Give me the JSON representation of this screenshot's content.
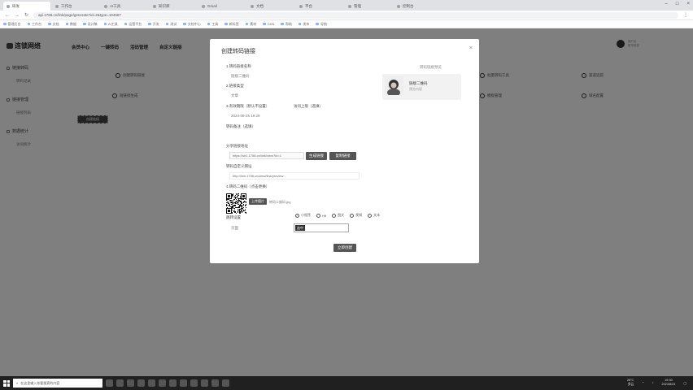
{
  "browser": {
    "tabs": [
      {
        "title": "研发",
        "active": true
      },
      {
        "title": "工作台"
      },
      {
        "title": "AI工具"
      },
      {
        "title": "知识库"
      },
      {
        "title": "Gmail"
      },
      {
        "title": "文档"
      },
      {
        "title": "平台"
      },
      {
        "title": "管理"
      },
      {
        "title": "控制台"
      }
    ],
    "url": "api.1758.cn/link/page/generate?id=2&type=104587",
    "bookmarks": [
      "管理后台",
      "工作台",
      "文档",
      "数据",
      "设计稿",
      "AI工具",
      "运营平台",
      "开发",
      "测试",
      "文档中心",
      "工具",
      "新标签",
      "素材",
      "CDN",
      "帮助",
      "发布",
      "导航"
    ]
  },
  "app": {
    "logo": "连锁网络",
    "nav": [
      "会员中心",
      "一键转码",
      "活码管理",
      "自定义链接"
    ],
    "user": {
      "name": "用户名",
      "subtitle": "账号信息"
    }
  },
  "sidebar": {
    "groups": [
      {
        "label": "链接转码",
        "sub": "转码记录"
      },
      {
        "label": "链接管理",
        "sub": "链接列表"
      },
      {
        "label": "数据统计",
        "sub": "访问统计"
      }
    ]
  },
  "main": {
    "row1": [
      {
        "label": "创建转码链接"
      },
      {
        "label": "批量转码工具"
      },
      {
        "label": "渠道追踪"
      }
    ],
    "row2": [
      {
        "label": "短链接生成"
      },
      {
        "label": "模板管理"
      },
      {
        "label": "域名配置"
      }
    ],
    "dark_button": "创建链接"
  },
  "modal": {
    "title": "创建转码链接",
    "fields": {
      "name_label": "1.转码链接名称",
      "name_value": "链接二维码",
      "type_label": "2.链接类型",
      "type_value": "文章",
      "date_label": "3.有效期限（默认不设置）",
      "date_value": "2024-08-25 19:29",
      "status_label": "访问上限（选填）",
      "remark_label": "转码备注（选填）",
      "share_label": "分享链接地址",
      "share_value": "https://sh1.1758.cn/link/view?id=1",
      "gen_button": "生成链接",
      "copy_button": "复制链接",
      "custom_label": "转码自定义网址",
      "custom_value": "http://link.1758.cn/view/link/preview",
      "qr_label": "4.转码二维码（点击更换）",
      "qr_upload_button": "上传图片",
      "qr_filename": "转码二维码.jpg",
      "mode_label": "跳转设置",
      "mode_options": [
        {
          "label": "小程序",
          "checked": true
        },
        {
          "label": "H5",
          "checked": false
        },
        {
          "label": "图文",
          "checked": false
        },
        {
          "label": "视频",
          "checked": false
        },
        {
          "label": "文本",
          "checked": false
        }
      ],
      "extra_label": "页面",
      "selected_value": "选中",
      "submit_button": "立即创建"
    },
    "preview": {
      "title": "转码链接预览",
      "card_title": "链接二维码",
      "card_subtitle": "预览内容"
    }
  },
  "taskbar": {
    "search_placeholder": "在这里输入你要搜索的内容",
    "weather": "28°C",
    "weather_desc": "多云",
    "time": "19:30",
    "date": "2024/8/24"
  }
}
